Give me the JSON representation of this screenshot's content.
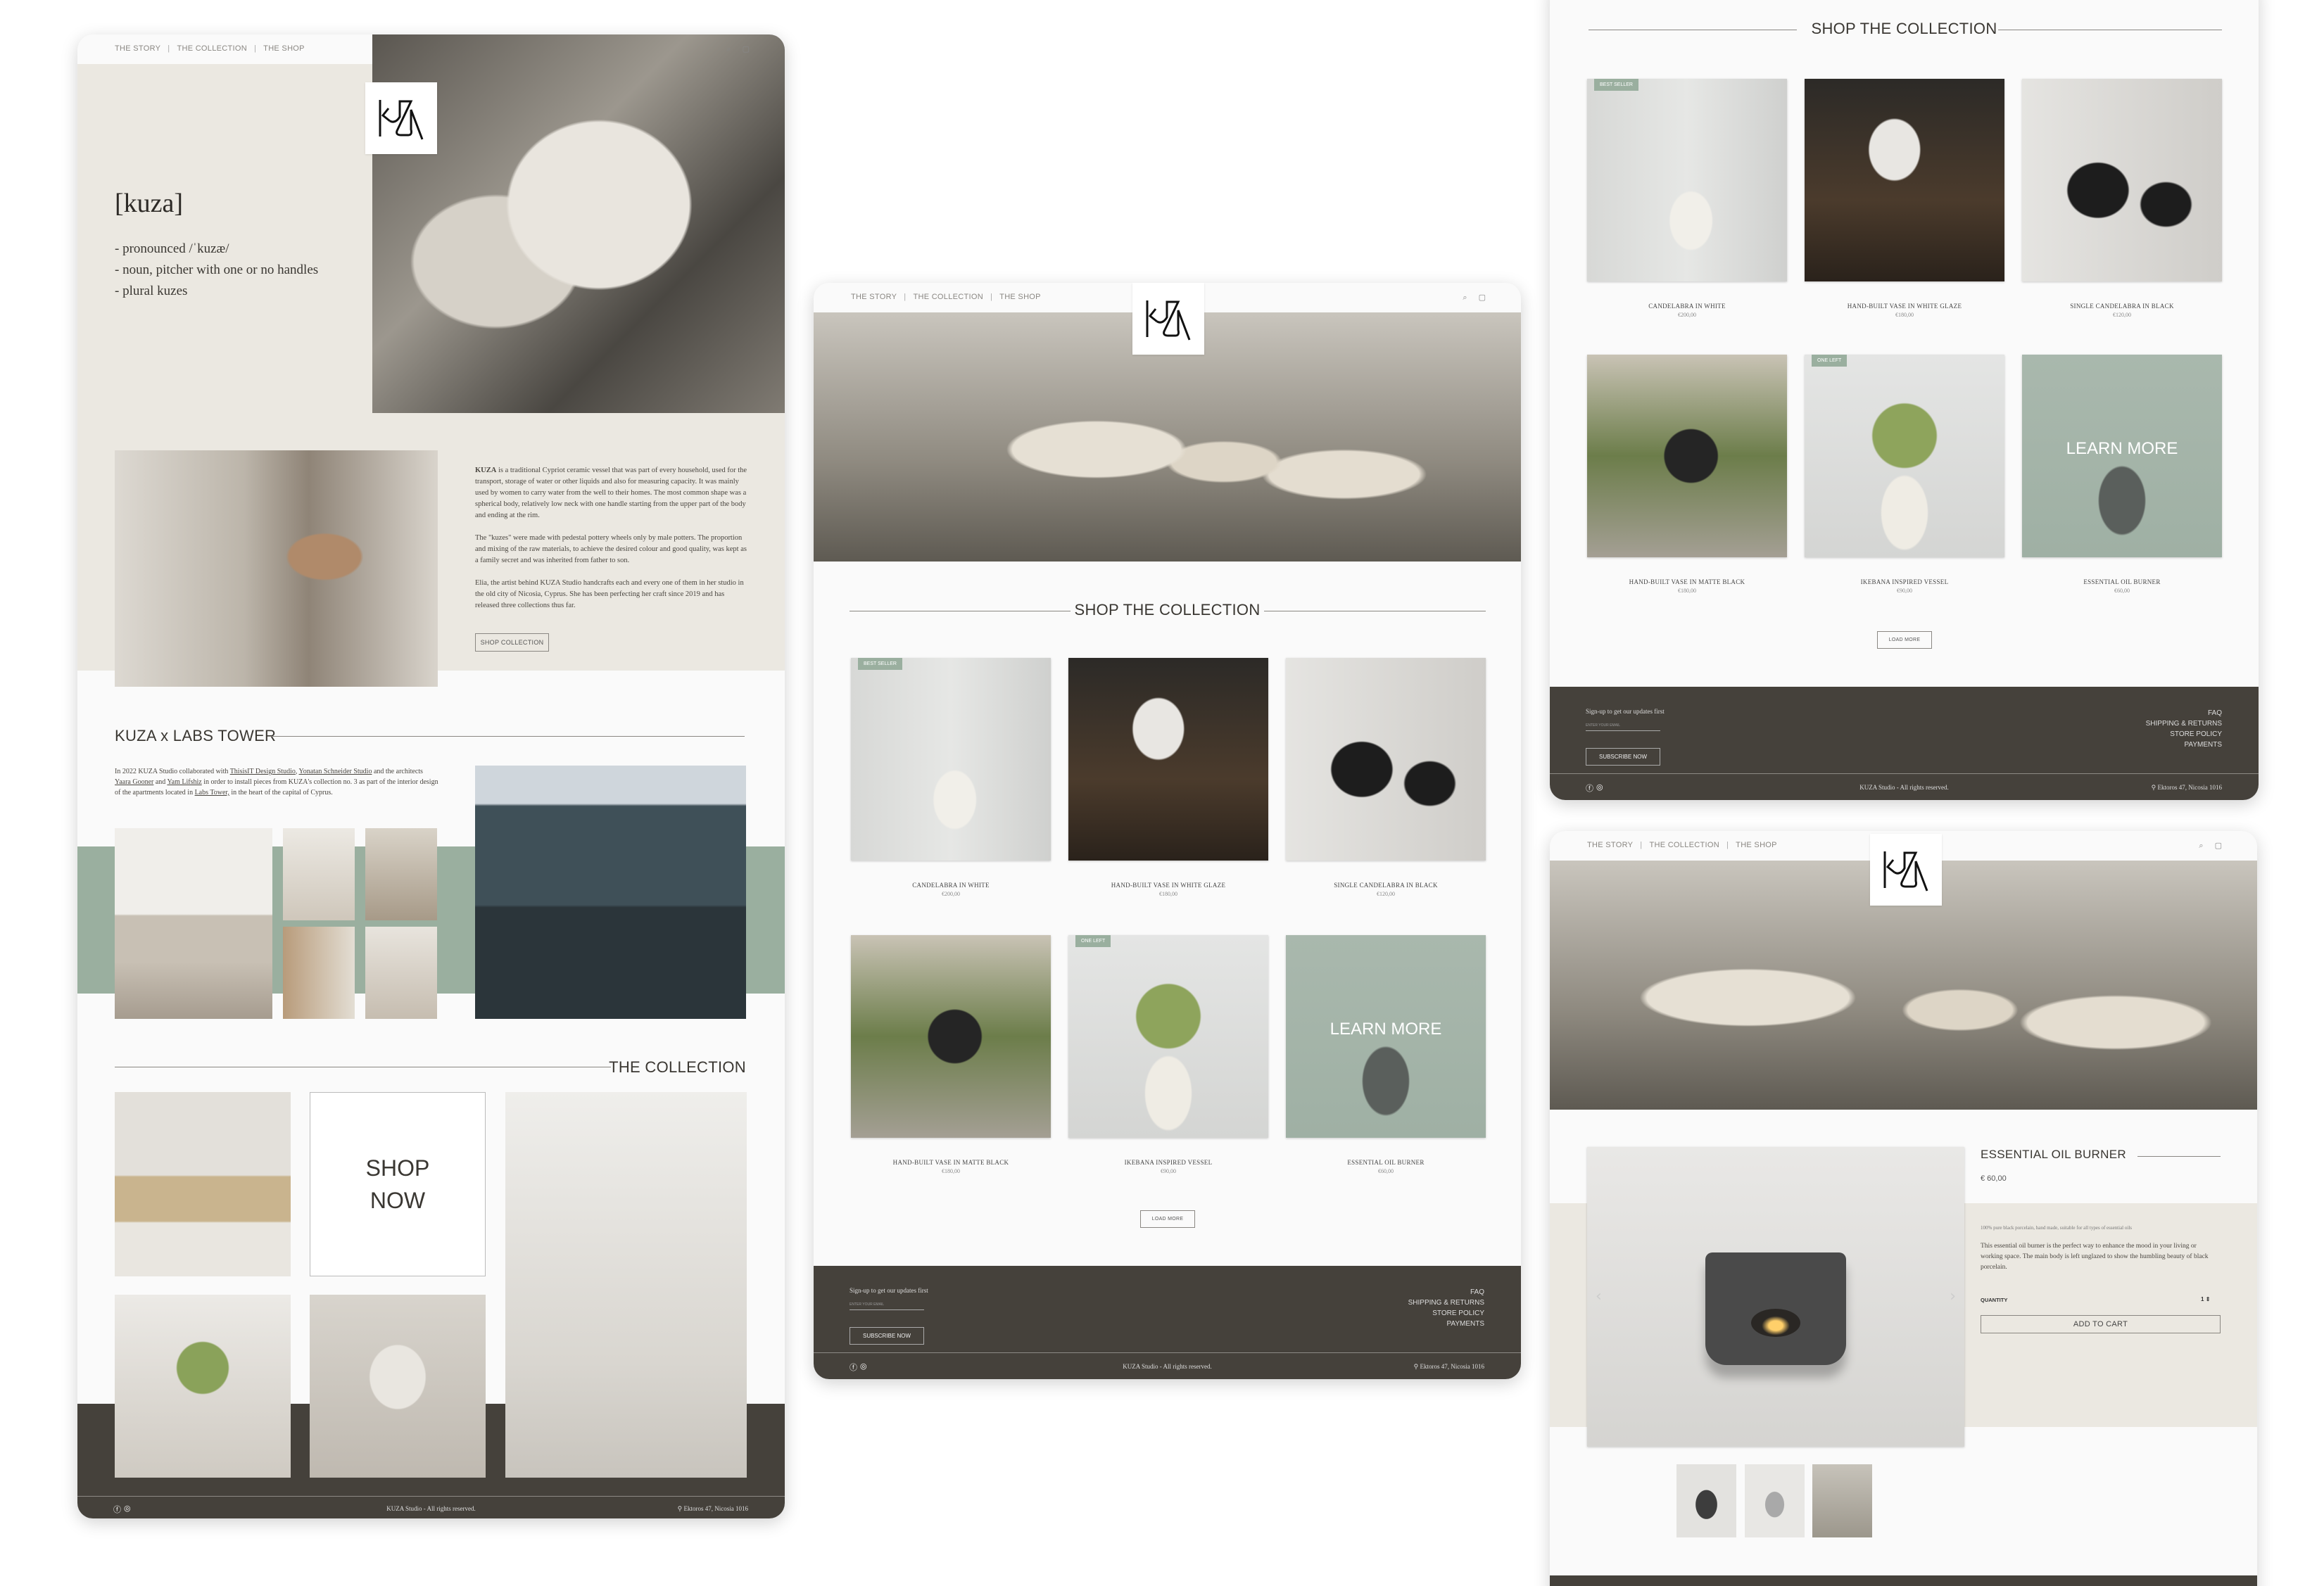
{
  "colors": {
    "beige": "#ebe8e1",
    "sage": "#9aaf9f",
    "dark": "#45413b",
    "background": "#fafafa"
  },
  "nav": {
    "items": [
      "THE STORY",
      "THE COLLECTION",
      "THE SHOP"
    ],
    "separator": "|",
    "icons": [
      "search-icon",
      "cart-icon"
    ]
  },
  "logo": {
    "text": "KUZA"
  },
  "story": {
    "title": "[kuza]",
    "definition": [
      "- pronounced /ˈkuzæ/",
      "- noun, pitcher with one or no handles",
      "- plural kuzes"
    ],
    "para1_bold": "KUZA",
    "para1": " is a traditional Cypriot ceramic vessel that was part of every household, used for the transport, storage of water or other liquids and also for measuring capacity. It was mainly used by women to carry water from the well to their homes. The most common shape was a spherical body, relatively low neck with one handle starting from the upper part of the body and ending at the rim.",
    "para2": "The \"kuzes\" were made with pedestal pottery wheels only by male potters. The proportion and mixing of the raw materials, to achieve the desired colour and good quality, was kept as a family secret and was inherited from father to son.",
    "para3": "Elia, the artist behind KUZA Studio handcrafts each and every one of them in her studio in the old city of Nicosia, Cyprus. She has been perfecting her craft since 2019 and has released three collections thus far.",
    "button": "SHOP COLLECTION"
  },
  "labs": {
    "title": "KUZA x LABS TOWER",
    "t1": "In 2022 KUZA Studio collaborated with ",
    "l1": "ThisisIT Design Studio",
    "t2": ", ",
    "l2": "Yonatan Schneider Studio",
    "t3": " and the architects ",
    "l3": "Yaara Gooner",
    "t4": " and ",
    "l4": "Yam Lifshiz",
    "t5": " in order to install pieces from KUZA's collection no. 3 as part of the interior design of the apartments located in ",
    "l5": "Labs Tower,",
    "t6": " in the heart of the capital of Cyprus."
  },
  "collection": {
    "title": "THE COLLECTION",
    "shop_now": [
      "SHOP",
      "NOW"
    ]
  },
  "shop": {
    "title": "SHOP THE COLLECTION",
    "load_more": "LOAD MORE",
    "products": [
      {
        "name": "CANDELABRA IN WHITE",
        "price": "€200,00",
        "badge": "BEST SELLER"
      },
      {
        "name": "HAND-BUILT VASE IN WHITE GLAZE",
        "price": "€180,00"
      },
      {
        "name": "SINGLE CANDELABRA IN BLACK",
        "price": "€120,00"
      },
      {
        "name": "HAND-BUILT VASE IN MATTE BLACK",
        "price": "€180,00"
      },
      {
        "name": "IKEBANA INSPIRED VESSEL",
        "price": "€90,00",
        "badge": "ONE LEFT"
      },
      {
        "name": "ESSENTIAL OIL BURNER",
        "price": "€60,00",
        "overlay": "LEARN MORE"
      }
    ]
  },
  "footer": {
    "signup": "Sign-up to get our updates first",
    "email_placeholder": "ENTER YOUR EMAIL",
    "subscribe": "SUBSCRIBE NOW",
    "links": [
      "FAQ",
      "SHIPPING & RETURNS",
      "STORE POLICY",
      "PAYMENTS"
    ],
    "copyright": "KUZA Studio - All rights reserved.",
    "address": "Ektoros 47, Nicosia 1016",
    "social_icons": [
      "facebook-icon",
      "instagram-icon"
    ]
  },
  "product": {
    "title": "ESSENTIAL OIL BURNER",
    "price": "€ 60,00",
    "tagline": "100% pure black porcelain, hand made, suitable for all types of essential oils",
    "description": "This essential oil burner is the perfect way to enhance the mood in your living or working space. The main body is left unglazed to show the humbling beauty of black porcelain.",
    "quantity_label": "QUANTITY",
    "quantity": "1",
    "add_to_cart": "ADD TO CART"
  }
}
